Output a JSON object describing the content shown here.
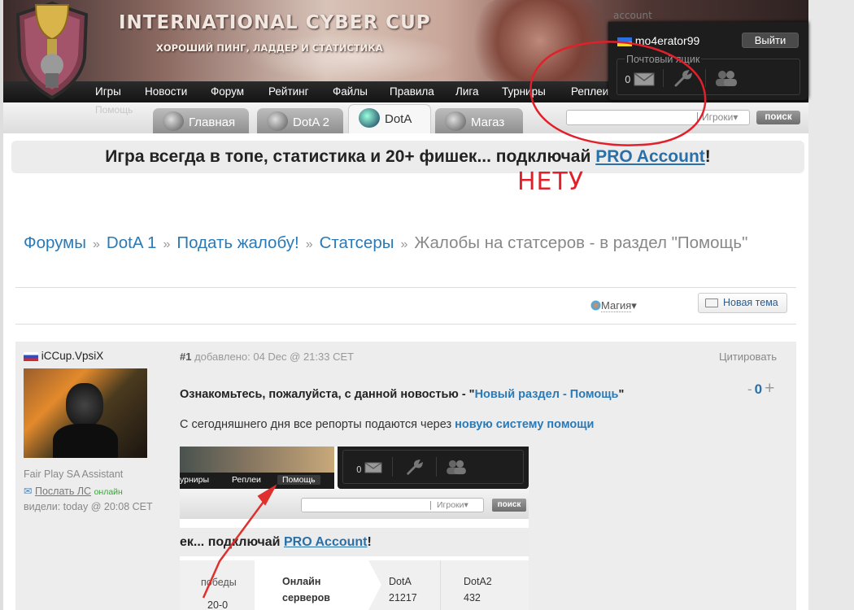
{
  "header": {
    "site_title": "INTERNATIONAL CYBER CUP",
    "site_subtitle": "ХОРОШИЙ ПИНГ, ЛАДДЕР И СТАТИСТИКА"
  },
  "nav": {
    "items": [
      "Игры",
      "Новости",
      "Форум",
      "Рейтинг",
      "Файлы",
      "Правила",
      "Лига",
      "Турниры",
      "Реплеи"
    ],
    "ghost_help": "Помощь"
  },
  "tabs": [
    {
      "label": "Главная"
    },
    {
      "label": "DotA 2"
    },
    {
      "label": "DotA"
    },
    {
      "label": "Магаз"
    }
  ],
  "search": {
    "placeholder": "",
    "scope": "Игроки",
    "button": "поиск"
  },
  "user_panel": {
    "ghost_text": "account",
    "username": "mo4erator99",
    "logout": "Выйти",
    "mailbox_label": "Почтовый ящик",
    "mail_count": "0"
  },
  "promo": {
    "text_before": "Игра всегда в топе, статистика и 20+ фишек... подключай ",
    "link": "PRO Account",
    "text_after": "!"
  },
  "annotation": {
    "text": "НЕТУ",
    "color": "#e1202b"
  },
  "breadcrumb": {
    "items": [
      "Форумы",
      "DotA 1",
      "Подать жалобу!",
      "Статсеры"
    ],
    "separator": "»",
    "current": "Жалобы на статсеров - в раздел \"Помощь\""
  },
  "toolbar": {
    "magic": "Магия",
    "new_topic": "Новая тема"
  },
  "post": {
    "author": "iCCup.VpsiX",
    "role": "Fair Play SA Assistant",
    "pm_link": "Послать ЛС",
    "online": "онлайн",
    "seen": "видели: today @ 20:08 CET",
    "number": "#1",
    "added": "добавлено: 04 Dec @ 21:33 CET",
    "quote": "Цитировать",
    "rating_minus": "-",
    "rating_value": "0",
    "rating_plus": "+",
    "p1_before": "Ознакомьтесь, пожалуйста, с данной новостью - \"",
    "p1_link": "Новый раздел - Помощь",
    "p1_after": "\"",
    "p2_before": "С сегодняшнего дня все репорты подаются через ",
    "p2_link": "новую систему помощи"
  },
  "embed": {
    "nav": [
      "урниры",
      "Реплеи",
      "Помощь"
    ],
    "mail_count": "0",
    "scope": "Игроки",
    "button": "поиск",
    "promo_before": "ек... подключай ",
    "promo_link": "PRO Account",
    "promo_after": "!",
    "stats": {
      "wins_label": "победы",
      "wins_value": "20-0",
      "online_label_1": "Онлайн",
      "online_label_2": "серверов",
      "dota_label": "DotA",
      "dota_value": "21217",
      "dota2_label": "DotA2",
      "dota2_value": "432"
    }
  }
}
